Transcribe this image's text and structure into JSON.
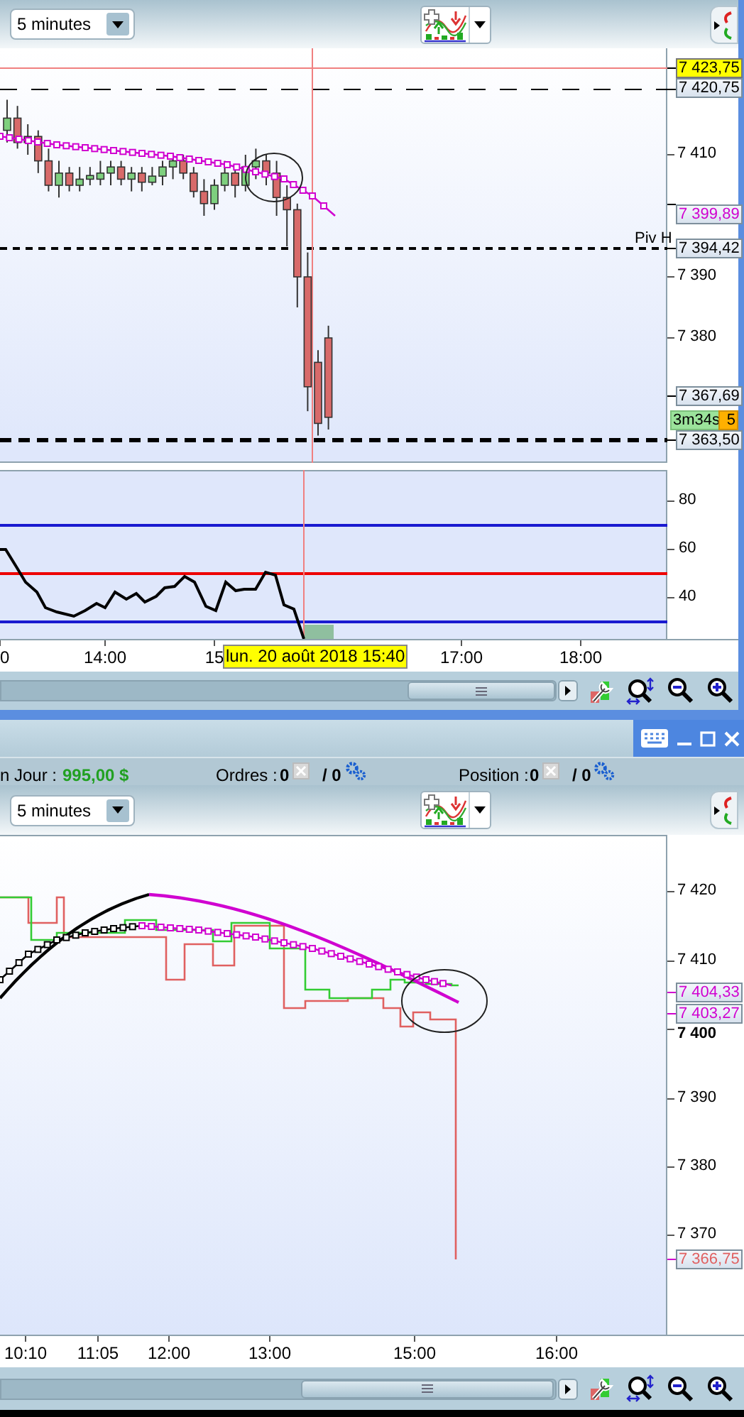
{
  "top_window": {
    "toolbar": {
      "timeframe": "5 minutes"
    },
    "price_chart": {
      "axis_ticks": [
        "7 410",
        "7 390",
        "7 380"
      ],
      "pivot_label": "Piv H",
      "price_labels": [
        {
          "text": "7 423,75",
          "kind": "last"
        },
        {
          "text": "7 420,75",
          "kind": "level"
        },
        {
          "text": "7 399,89",
          "kind": "average"
        },
        {
          "text": "7 394,42",
          "kind": "level"
        },
        {
          "text": "7 367,69",
          "kind": "level"
        },
        {
          "text": "3m34s",
          "kind": "countdown"
        },
        {
          "text": "5",
          "kind": "bid"
        },
        {
          "text": "7 363,50",
          "kind": "level"
        }
      ]
    },
    "oscillator": {
      "axis_ticks": [
        "80",
        "60",
        "40"
      ]
    },
    "time_axis": {
      "ticks": [
        "0",
        "14:00",
        "15",
        "17:00",
        "18:00"
      ],
      "cursor_label": "lun. 20 août 2018 15:40"
    }
  },
  "bottom_window": {
    "info_bar": {
      "pnl": {
        "label": "n Jour :",
        "value": "995,00 $"
      },
      "counters": [
        {
          "label": "Ordres :",
          "count": "0",
          "total": "/ 0"
        },
        {
          "label": "Position :",
          "count": "0",
          "total": "/ 0"
        }
      ]
    },
    "toolbar": {
      "timeframe": "5 minutes"
    },
    "price_chart": {
      "axis_ticks": [
        "7 420",
        "7 410",
        "7 400",
        "7 390",
        "7 380",
        "7 370"
      ],
      "price_labels": [
        {
          "text": "7 404,33",
          "kind": "average"
        },
        {
          "text": "7 403,27",
          "kind": "average"
        },
        {
          "text": "7 366,75",
          "kind": "low"
        }
      ]
    },
    "time_axis": {
      "ticks": [
        "10:10",
        "11:05",
        "12:00",
        "13:00",
        "15:00",
        "16:00"
      ]
    }
  }
}
